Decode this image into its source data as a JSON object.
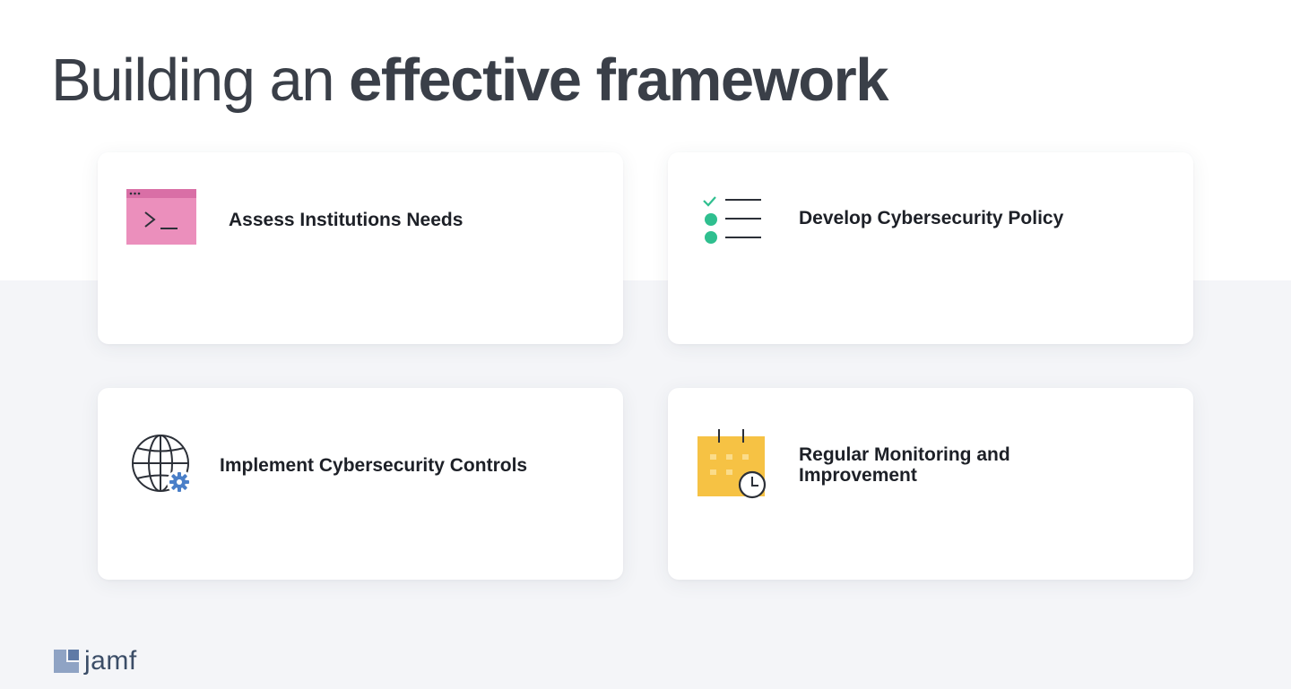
{
  "slide": {
    "title_regular": "Building an ",
    "title_bold": "effective framework"
  },
  "cards": [
    {
      "label": "Assess Institutions Needs",
      "icon": "terminal-window-icon"
    },
    {
      "label": "Develop Cybersecurity Policy",
      "icon": "checklist-icon"
    },
    {
      "label": "Implement Cybersecurity Controls",
      "icon": "globe-gear-icon"
    },
    {
      "label": "Regular Monitoring and Improvement",
      "icon": "calendar-clock-icon"
    }
  ],
  "brand": {
    "name": "jamf",
    "logo_icon": "jamf-logo-icon"
  },
  "colors": {
    "terminal_pink": "#eb8fbc",
    "terminal_pink_dark": "#d96fa6",
    "checklist_green": "#2fbf8f",
    "gear_blue": "#4a7fc8",
    "calendar_yellow": "#f6c244",
    "brand_blue": "#8fa3c4"
  }
}
